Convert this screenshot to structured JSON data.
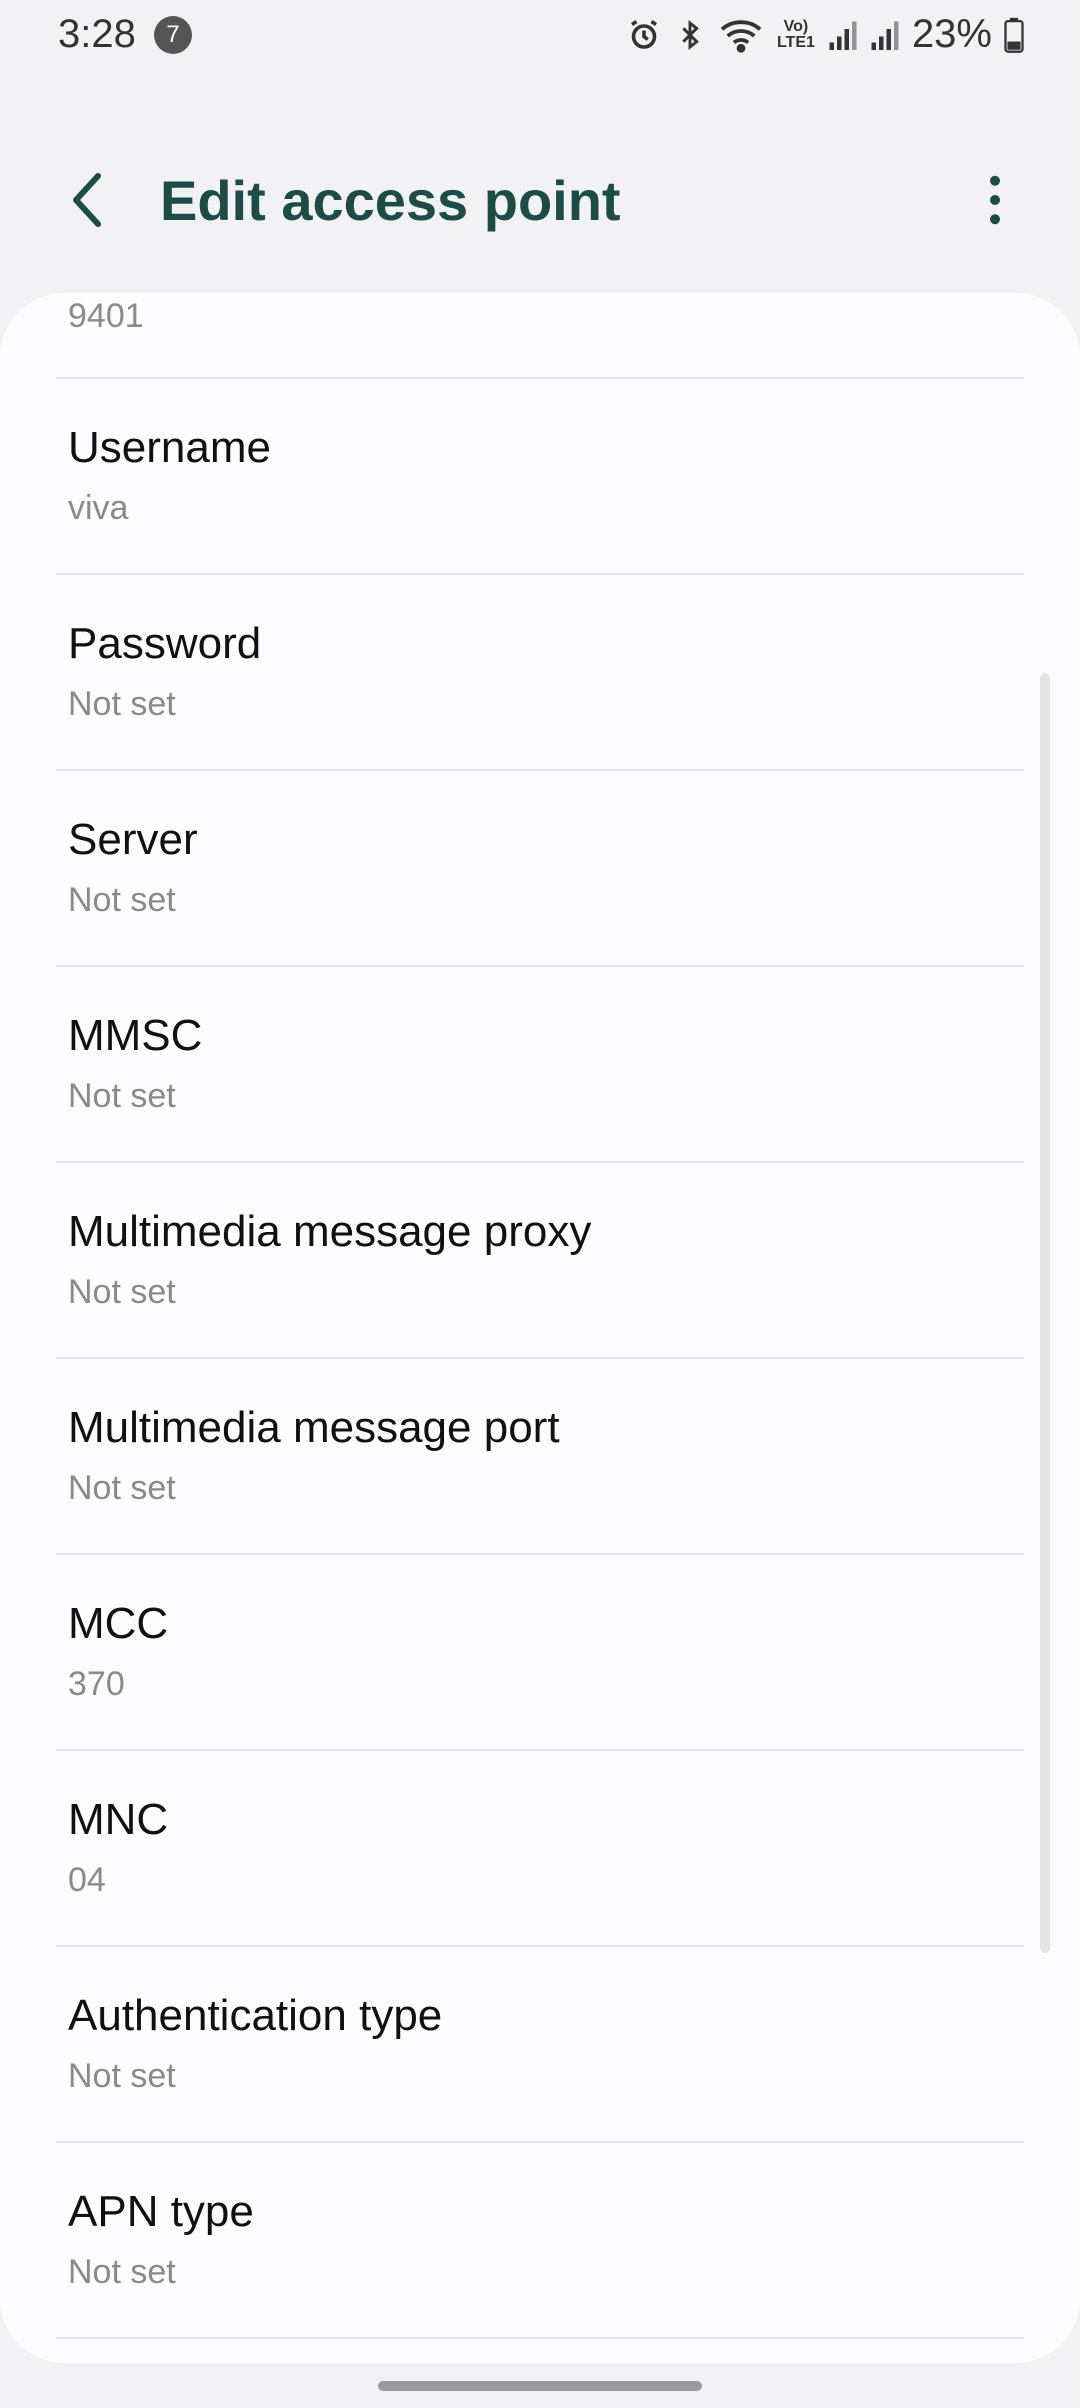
{
  "status_bar": {
    "time": "3:28",
    "notification_count": "7",
    "battery": "23%",
    "volte_label": "Vo) LTE1"
  },
  "app_bar": {
    "title": "Edit access point"
  },
  "partial_row": {
    "value": "9401"
  },
  "rows": [
    {
      "label": "Username",
      "value": "viva"
    },
    {
      "label": "Password",
      "value": "Not set"
    },
    {
      "label": "Server",
      "value": "Not set"
    },
    {
      "label": "MMSC",
      "value": "Not set"
    },
    {
      "label": "Multimedia message proxy",
      "value": "Not set"
    },
    {
      "label": "Multimedia message port",
      "value": "Not set"
    },
    {
      "label": "MCC",
      "value": "370"
    },
    {
      "label": "MNC",
      "value": "04"
    },
    {
      "label": "Authentication type",
      "value": "Not set"
    },
    {
      "label": "APN type",
      "value": "Not set"
    }
  ],
  "colors": {
    "title": "#1b4d44",
    "background": "#f2f2f4",
    "card": "#fcfcfe",
    "secondary_text": "#8a8a8a"
  },
  "icons": [
    "back-icon",
    "more-options-icon",
    "alarm-icon",
    "bluetooth-icon",
    "wifi-icon",
    "signal-icon",
    "battery-icon"
  ]
}
